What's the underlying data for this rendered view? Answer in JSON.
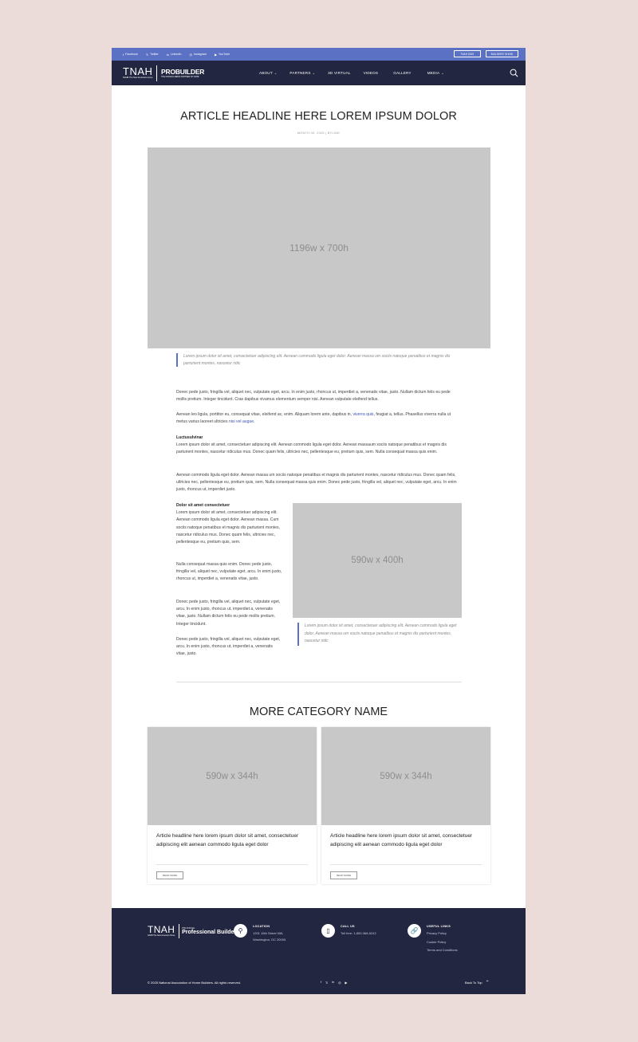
{
  "topbar": {
    "social": [
      {
        "icon": "facebook-icon",
        "glyph": "f",
        "label": "Facebook"
      },
      {
        "icon": "twitter-x-icon",
        "glyph": "𝕏",
        "label": "Twitter"
      },
      {
        "icon": "linkedin-icon",
        "glyph": "in",
        "label": "LinkedIn"
      },
      {
        "icon": "instagram-icon",
        "glyph": "◎",
        "label": "Instagram"
      },
      {
        "icon": "youtube-icon",
        "glyph": "▶",
        "label": "YouTube"
      }
    ],
    "buttons": [
      "TNAH 2025",
      "BUILDERS' SHOW"
    ]
  },
  "nav": {
    "logo": {
      "main": "TNAH",
      "sub": "NAHB The New American Home",
      "pro": "PROBUILDER",
      "pro_sub": "THE OFFICIAL MEDIA PARTNER OF NAHB"
    },
    "links": [
      {
        "label": "ABOUT",
        "dropdown": true
      },
      {
        "label": "PARTNERS",
        "dropdown": true
      },
      {
        "label": "3D VIRTUAL",
        "dropdown": false
      },
      {
        "label": "VIDEOS",
        "dropdown": false
      },
      {
        "label": "GALLERY",
        "dropdown": false
      },
      {
        "label": "MEDIA",
        "dropdown": true
      }
    ]
  },
  "article": {
    "headline": "ARTICLE HEADLINE HERE LOREM IPSUM DOLOR",
    "meta": "MONTH 00, 2025  |  BYLINE",
    "hero_placeholder": "1196w x 700h",
    "hero_caption": "Lorem ipsum dolor sit amet, consectetuer adipiscing elit. Aenean commodo ligula eget dolor. Aenean massa um sociis natoque penatibus et magnis dis parturient montes, nascetur ridic",
    "p1": "Donec pede justo, fringilla vel, aliquet nec, vulputate eget, arcu. In enim justo, rhoncus ut, imperdiet a, venenatis vitae, justo. Nullam dictum felis eu pede mollis pretium. Integer tincidunt. Cras dapibus vivamus elementum semper nisi. Aenean vulputate eleifend tellus.",
    "p2_a": "Aenean leo ligula, porttitor eu, consequat vitae, eleifend ac, enim. Aliquam lorem ante, dapibus in, ",
    "p2_link1": "viverra quis",
    "p2_b": ", feugiat a, tellus. Phasellus viverra nulla ut metus varius laoreet ultricies ",
    "p2_link2": "nisi vel augue",
    "p2_c": ".",
    "h1": "Luctusulvinar",
    "p3": "Lorem ipsum dolor sit amet, consectetuer adipiscing elit. Aenean commodo ligula eget dolor. Aenean massaum sociis natoque penatibus et magnis dis parturient montes, nascetur ridiculus mus. Donec quam felis, ultricies nec, pellentesque eu, pretium quis, sem. Nulla consequat massa quis enim.",
    "p4": "Aenean commodo ligula eget dolor. Aenean massa um sociis natoque penatibus et magnis dis parturient montes, nascetur ridiculus mus. Donec quam felis, ultricies nec, pellentesque eu, pretium quis, sem. Nulla consequat massa quis enim. Donec pede justo, fringilla vel, aliquet nec, vulputate eget, arcu. In enim justo, rhoncus ut, imperdiet justo.",
    "h2": "Dolor sit amet consectetuer",
    "col_p1": "Lorem ipsum dolor sit amet, consectetuer adipiscing elit. Aenean commodo ligula eget dolor. Aenean massa. Cum sociis natoque penatibus et magnis dis parturient montes, nascetur ridiculus mus. Donec quam felis, ultricies nec, pellentesque eu, pretium quis, sem.",
    "col_p2": "Nulla consequat massa quis enim. Donec pede justo, fringilla vel, aliquet nec, vulputate eget, arcu. In enim justo, rhoncus ut, imperdiet a, venenatis vitae, justo.",
    "col_p3": "Donec pede justo, fringilla vel, aliquet nec, vulputate eget, arcu. In enim justo, rhoncus ut, imperdiet a, venenatis vitae, justo. Nullam dictum felis eu pede mollis pretium. Integer tincidunt.",
    "col_p4": "Donec pede justo, fringilla vel, aliquet nec, vulputate eget, arcu. In enim justo, rhoncus ut, imperdiet a, venenatis vitae, justo.",
    "inline_placeholder": "590w x 400h",
    "inline_caption": "Lorem ipsum dolor sit amet, consectetuer adipiscing elit. Aenean commodo ligula eget dolor. Aenean massa um sociis natoque penatibus et magnis dis parturient montes, nascetur ridic"
  },
  "more": {
    "title": "MORE CATEGORY NAME",
    "cards": [
      {
        "placeholder": "590w x 344h",
        "title": "Article headline here lorem ipsum dolor sit amet, consectetuer adipiscing elit aenean commodo ligula eget dolor",
        "button": "READ MORE"
      },
      {
        "placeholder": "590w x 344h",
        "title": "Article headline here lorem ipsum dolor sit amet, consectetuer adipiscing elit aenean commodo ligula eget dolor",
        "button": "READ MORE"
      }
    ]
  },
  "footer": {
    "logo": {
      "main": "TNAH",
      "sub": "NAHB The New American Home",
      "pro_small": "THE OFFICIAL",
      "pro": "Professional Builder"
    },
    "location": {
      "heading": "LOCATION",
      "line1": "1201 15th Street NW,",
      "line2": "Washington, DC 20005"
    },
    "call": {
      "heading": "CALL US",
      "line1": "Toll free: 1-800-368-5242"
    },
    "links": {
      "heading": "USEFUL LINKS",
      "items": [
        "Privacy Policy",
        "Cookie Policy",
        "Terms and Conditions"
      ]
    },
    "copyright": "© 2025 National Association of Home Builders. All rights reserved.",
    "social": [
      "f",
      "𝕏",
      "in",
      "◎",
      "▶"
    ],
    "back_to_top": "Back To Top"
  },
  "colors": {
    "accent": "#5b72c4",
    "navy": "#232640",
    "placeholder": "#c8c8c8",
    "backdrop": "#ecdcd9",
    "link": "#3d52b3"
  }
}
